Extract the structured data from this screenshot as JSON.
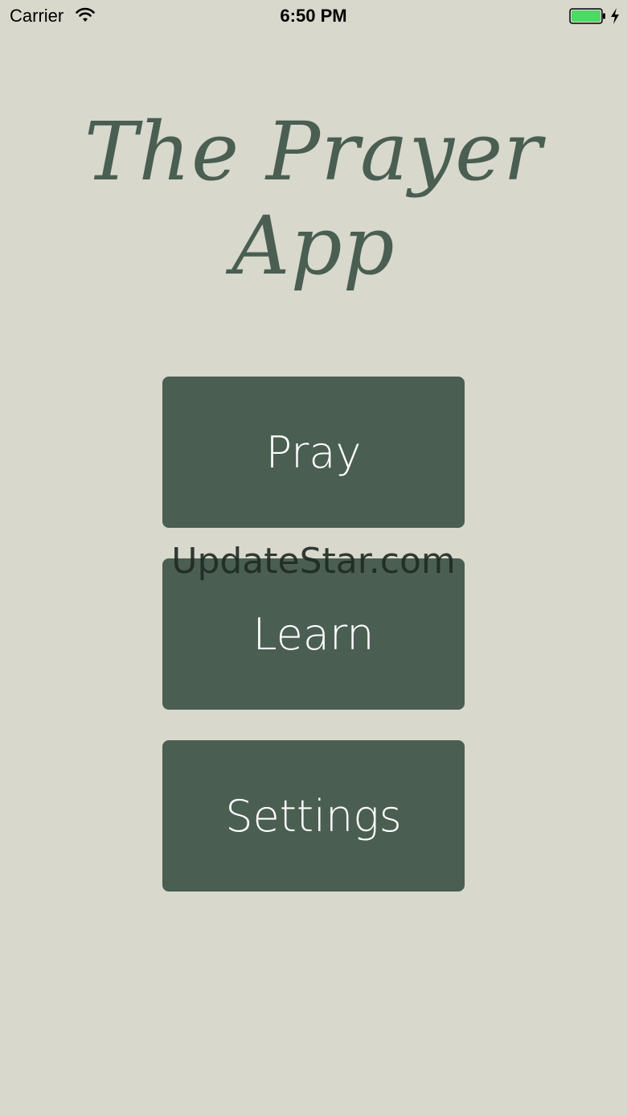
{
  "status_bar": {
    "carrier": "Carrier",
    "time": "6:50 PM",
    "battery_color": "#4cd964"
  },
  "title": "The Prayer App",
  "menu": {
    "pray_label": "Pray",
    "learn_label": "Learn",
    "settings_label": "Settings"
  },
  "watermark": "UpdateStar.com",
  "colors": {
    "background": "#d8d8cc",
    "accent": "#4a5e52",
    "button_text": "#ffffff"
  }
}
